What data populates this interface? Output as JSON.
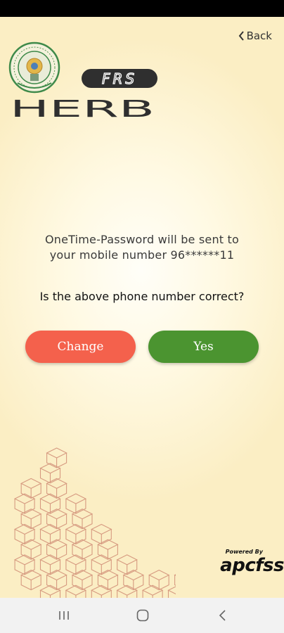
{
  "header": {
    "back_label": "Back",
    "logo_tag": "FRS",
    "logo_name": "HERB"
  },
  "message": {
    "line1": "OneTime-Password will be sent to",
    "line2": "your mobile number 96******11",
    "question": "Is the above phone number correct?"
  },
  "buttons": {
    "change_label": "Change",
    "yes_label": "Yes"
  },
  "footer": {
    "powered_by": "Powered By",
    "brand": "apcfss"
  },
  "colors": {
    "change": "#f4614c",
    "yes": "#4b9430",
    "pattern": "#d69a80"
  },
  "icons": {
    "back": "chevron-left-icon",
    "emblem": "state-emblem-icon",
    "nav_recents": "recents-icon",
    "nav_home": "home-icon",
    "nav_back": "nav-back-icon"
  }
}
